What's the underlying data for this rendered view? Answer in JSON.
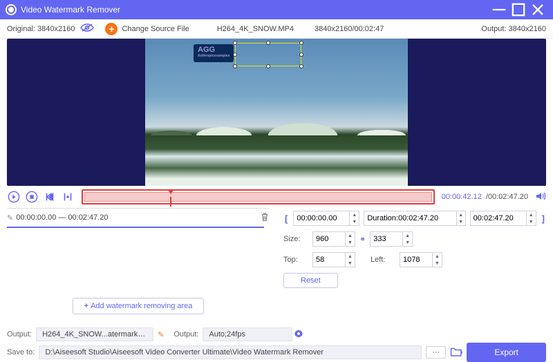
{
  "titlebar": {
    "title": "Video Watermark Remover"
  },
  "infobar": {
    "original_label": "Original:",
    "original_value": "3840x2160",
    "change_source": "Change Source File",
    "filename": "H264_4K_SNOW.MP4",
    "resdur": "3840x2160/00:02:47",
    "output_label": "Output:",
    "output_value": "3840x2160"
  },
  "preview": {
    "badge": "AGG",
    "badge_sub": "Anthropicexamples"
  },
  "playbar": {
    "current": "00:00:42.12",
    "total": "/00:02:47.20"
  },
  "area": {
    "range": "00:00:00.00 — 00:02:47.20",
    "add_label": "Add watermark removing area"
  },
  "trim": {
    "start": "00:00:00.00",
    "dur_label": "Duration:",
    "dur": "00:02:47.20",
    "end": "00:02:47.20"
  },
  "size": {
    "label": "Size:",
    "w": "960",
    "h": "333",
    "top_label": "Top:",
    "top": "58",
    "left_label": "Left:",
    "left": "1078"
  },
  "reset": "Reset",
  "bottom": {
    "output_label": "Output:",
    "output_file": "H264_4K_SNOW...atermark.mp4",
    "fmt_label": "Output:",
    "fmt": "Auto;24fps",
    "saveto_label": "Save to:",
    "saveto": "D:\\Aiseesoft Studio\\Aiseesoft Video Converter Ultimate\\Video Watermark Remover",
    "export": "Export"
  }
}
